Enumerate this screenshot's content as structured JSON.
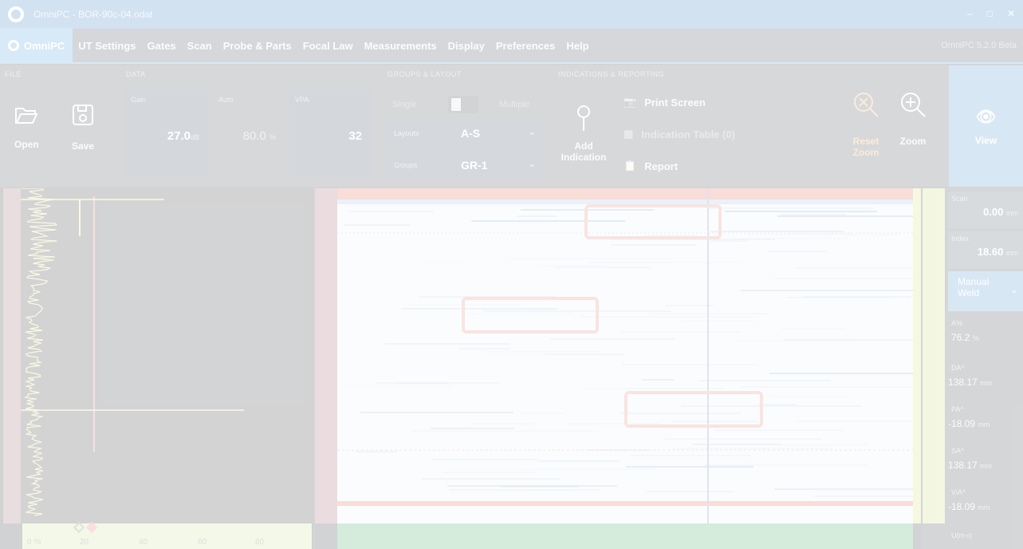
{
  "window": {
    "title": "OmniPC - BOR-90c-04.odat"
  },
  "menu": {
    "home_label": "OmniPC",
    "items": [
      "UT Settings",
      "Gates",
      "Scan",
      "Probe & Parts",
      "Focal Law",
      "Measurements",
      "Display",
      "Preferences",
      "Help"
    ],
    "version": "OmniPC 5.2.0 Beta"
  },
  "ribbon": {
    "file": {
      "title": "FILE",
      "open": "Open",
      "save": "Save"
    },
    "data": {
      "title": "DATA",
      "gain": {
        "label": "Gain",
        "value": "27.0",
        "unit": "dB"
      },
      "auto": {
        "label": "Auto",
        "value": "80.0",
        "unit": "%"
      },
      "vpa": {
        "label": "VPA",
        "value": "32"
      }
    },
    "groups_layout": {
      "title": "GROUPS & LAYOUT",
      "single": "Single",
      "multiple": "Multiple",
      "layouts_label": "Layouts",
      "layouts_value": "A-S",
      "groups_label": "Groups",
      "groups_value": "GR-1"
    },
    "indications": {
      "title": "INDICATIONS & REPORTING",
      "add_indication": "Add Indication",
      "print_screen": "Print Screen",
      "indication_table": "Indication Table (0)",
      "report": "Report"
    },
    "zoom": {
      "reset": "Reset Zoom",
      "zoom": "Zoom"
    },
    "view": "View"
  },
  "ascan": {
    "scale_labels": [
      "0 %",
      "20",
      "40",
      "60",
      "80"
    ]
  },
  "readout": {
    "scan": {
      "label": "Scan",
      "value": "0.00",
      "unit": "mm"
    },
    "index": {
      "label": "Index",
      "value": "18.60",
      "unit": "mm"
    },
    "mode": "Manual Weld",
    "measurements": [
      {
        "label": "A%",
        "value": "76.2",
        "unit": "%"
      },
      {
        "label": "DA^",
        "value": "138.17",
        "unit": "mm"
      },
      {
        "label": "PA^",
        "value": "-18.09",
        "unit": "mm"
      },
      {
        "label": "SA^",
        "value": "138.17",
        "unit": "mm"
      },
      {
        "label": "ViA^",
        "value": "-18.09",
        "unit": "mm"
      }
    ],
    "footer": "U(m-r)"
  },
  "colors": {
    "accent": "#3d8fd6",
    "indication_box": "#e07b6b",
    "ascan_signal": "#e8e26a",
    "cursor": "#e06060"
  }
}
